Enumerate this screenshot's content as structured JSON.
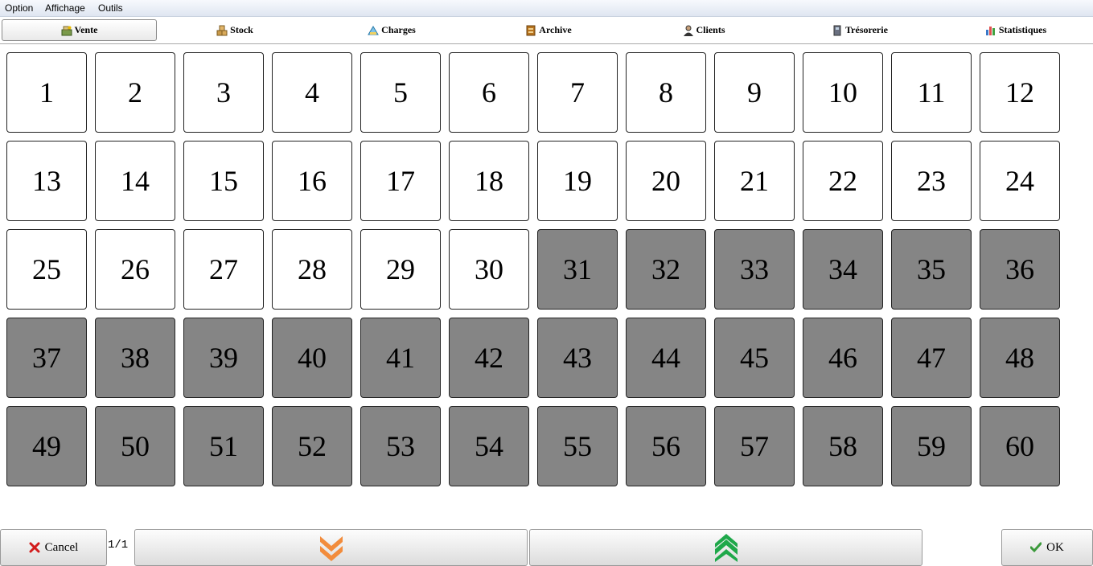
{
  "menu": {
    "items": [
      "Option",
      "Affichage",
      "Outils"
    ]
  },
  "tabs": [
    {
      "label": "Vente",
      "icon": "cash-register-icon",
      "active": true
    },
    {
      "label": "Stock",
      "icon": "boxes-icon",
      "active": false
    },
    {
      "label": "Charges",
      "icon": "charges-icon",
      "active": false
    },
    {
      "label": "Archive",
      "icon": "archive-icon",
      "active": false
    },
    {
      "label": "Clients",
      "icon": "client-person-icon",
      "active": false
    },
    {
      "label": "Trésorerie",
      "icon": "treasury-icon",
      "active": false
    },
    {
      "label": "Statistiques",
      "icon": "bar-chart-icon",
      "active": false
    }
  ],
  "tables": {
    "count": 60,
    "free_until": 30,
    "colors": {
      "free": "#ffffff",
      "occupied": "#858585"
    }
  },
  "footer": {
    "cancel_label": "Cancel",
    "page_indicator": "1/1",
    "ok_label": "OK",
    "colors": {
      "cancel_icon": "#d21b1b",
      "down_arrow": "#f28c3c",
      "up_arrow": "#1fa84a",
      "ok_icon": "#3c9a3c"
    }
  }
}
